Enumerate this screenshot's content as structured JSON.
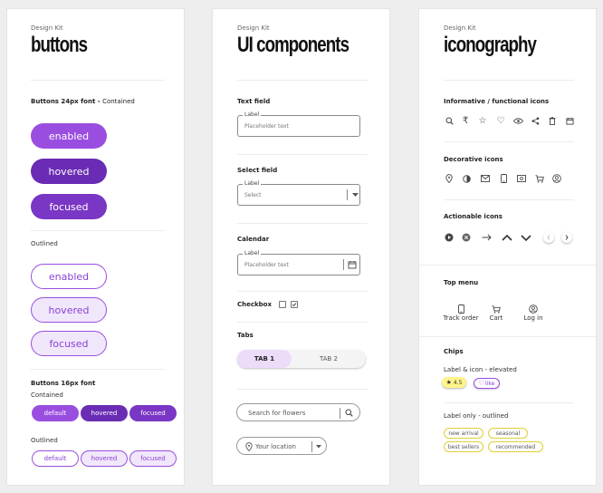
{
  "colors": {
    "primary": "#9a4ee0",
    "hovered": "#6a2cb4",
    "focused": "#7a36c4",
    "tint": "#f1e7fb",
    "chip_yellow": "#fff48a"
  },
  "panel1": {
    "kit": "Design Kit",
    "title": "buttons",
    "section1_bold": "Buttons 24px font - ",
    "section1_rest": "Contained",
    "contained": [
      "enabled",
      "hovered",
      "focused"
    ],
    "outlined_label": "Outlined",
    "outlined": [
      "enabled",
      "hovered",
      "focused"
    ],
    "section2": "Buttons 16px font",
    "contained_label": "Contained",
    "small_contained": [
      "default",
      "hovered",
      "focused"
    ],
    "outlined_label2": "Outlined",
    "small_outlined": [
      "default",
      "hovered",
      "focused"
    ]
  },
  "panel2": {
    "kit": "Design Kit",
    "title": "UI components",
    "textfield": {
      "heading": "Text field",
      "label": "Label",
      "placeholder": "Placeholder text"
    },
    "select": {
      "heading": "Select field",
      "label": "Label",
      "value": "Select"
    },
    "calendar": {
      "heading": "Calendar",
      "label": "Label",
      "placeholder": "Placeholder text"
    },
    "checkbox": {
      "heading": "Checkbox"
    },
    "tabs": {
      "heading": "Tabs",
      "items": [
        "TAB 1",
        "TAB 2"
      ]
    },
    "search": {
      "placeholder": "Search for flowers"
    },
    "location": {
      "placeholder": "Your location"
    }
  },
  "panel3": {
    "kit": "Design Kit",
    "title": "iconography",
    "informative": {
      "heading": "Informative / functional icons",
      "icons": [
        "search-icon",
        "rupee-icon",
        "star-icon",
        "heart-icon",
        "eye-icon",
        "share-icon",
        "trash-icon",
        "calendar-icon"
      ]
    },
    "decorative": {
      "heading": "Decorative icons",
      "icons": [
        "location-pin-icon",
        "contrast-icon",
        "mail-icon",
        "phone-icon",
        "cash-icon",
        "cart-icon",
        "user-circle-icon"
      ]
    },
    "actionable": {
      "heading": "Actionable icons",
      "icons": [
        "play-icon",
        "close-circle-icon",
        "arrow-right-icon",
        "chevron-up-icon",
        "chevron-down-icon",
        "chevron-left-icon",
        "chevron-right-icon"
      ]
    },
    "topmenu": {
      "heading": "Top  menu",
      "items": [
        {
          "label": "Track order",
          "icon": "phone-icon"
        },
        {
          "label": "Cart",
          "icon": "cart-icon"
        },
        {
          "label": "Log in",
          "icon": "user-circle-icon"
        }
      ]
    },
    "chips": {
      "heading": "Chips",
      "elevated_label": "Label & icon - elevated",
      "elevated": [
        {
          "label": "4.5",
          "icon": "star-icon"
        },
        {
          "label": "like",
          "icon": "heart-icon"
        }
      ],
      "outlined_label": "Label only - outlined",
      "outlined": [
        "new arrival",
        "seasonal",
        "best sellers",
        "recommended"
      ]
    }
  }
}
